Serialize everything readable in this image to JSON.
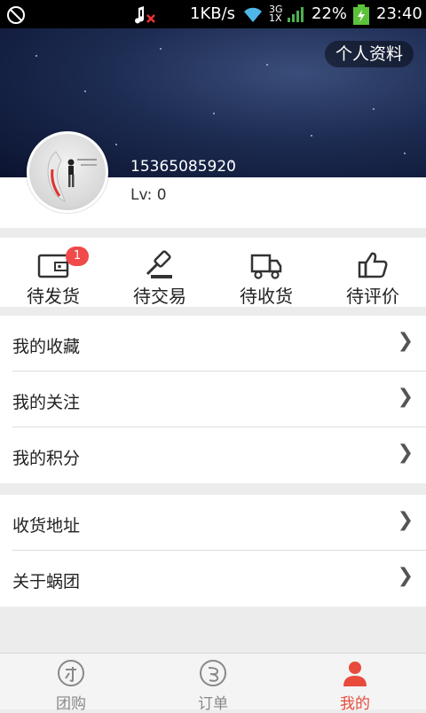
{
  "status_bar": {
    "speed": "1KB/s",
    "network": "3G",
    "network2": "1X",
    "battery": "22%",
    "time": "23:40"
  },
  "header": {
    "profile_label": "个人资料"
  },
  "user": {
    "phone": "15365085920",
    "level": "Lv: 0"
  },
  "orders": [
    {
      "label": "待发货",
      "badge": "1",
      "icon": "wallet-icon"
    },
    {
      "label": "待交易",
      "icon": "gavel-icon"
    },
    {
      "label": "待收货",
      "icon": "truck-icon"
    },
    {
      "label": "待评价",
      "icon": "thumbs-up-icon"
    }
  ],
  "menu1": [
    {
      "label": "我的收藏"
    },
    {
      "label": "我的关注"
    },
    {
      "label": "我的积分"
    }
  ],
  "menu2": [
    {
      "label": "收货地址"
    },
    {
      "label": "关于蜗团"
    }
  ],
  "tabs": [
    {
      "label": "团购",
      "icon": "group-buy-icon"
    },
    {
      "label": "订单",
      "icon": "order-icon"
    },
    {
      "label": "我的",
      "icon": "user-icon",
      "active": true
    }
  ],
  "colors": {
    "accent": "#e84b3c",
    "badge": "#f04a4a",
    "hero_dark": "#0b1330"
  }
}
